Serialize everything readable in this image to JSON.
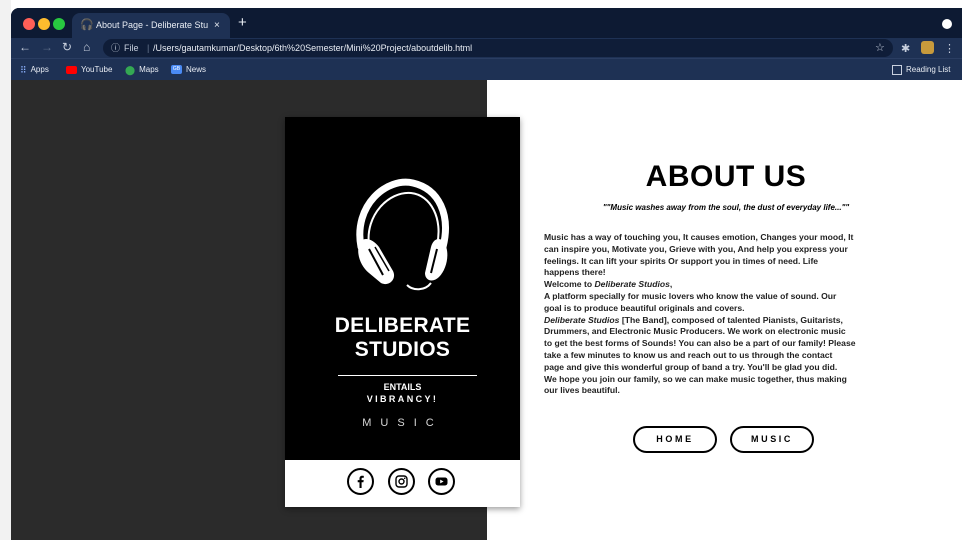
{
  "browser": {
    "tab_title": "About Page - Deliberate Studio",
    "tab_close": "×",
    "new_tab": "+",
    "url_scheme_label": "File",
    "url_separator": "|",
    "url": "/Users/gautamkumar/Desktop/6th%20Semester/Mini%20Project/aboutdelib.html",
    "bookmarks": [
      "Apps",
      "YouTube",
      "Maps",
      "News"
    ],
    "news_icon_text": "GB",
    "reading_list": "Reading List",
    "colors": {
      "frame": "#0d1a33",
      "toolbar": "#1e3154"
    }
  },
  "card": {
    "brand_line1": "DELIBERATE",
    "brand_line2": "STUDIOS",
    "tagline1": "ENTAILS",
    "tagline2": "VIBRANCY!",
    "category": "MUSIC",
    "social_icons": [
      "facebook-icon",
      "instagram-icon",
      "youtube-icon"
    ]
  },
  "about": {
    "title": "ABOUT US",
    "quote": "\"\"Music washes away from the soul, the dust of everyday life...\"\"",
    "lines": [
      "Music has a way of touching you, It causes emotion, Changes your mood, It",
      "can inspire you, Motivate you, Grieve with you, And help you express your",
      "feelings. It can lift your spirits Or support you in times of need. Life",
      "happens there!"
    ],
    "welcome_prefix": "Welcome to ",
    "welcome_brand": "Deliberate Studios",
    "welcome_suffix": ",",
    "platform_lines": [
      "A platform specially for music lovers who know the value of sound. Our",
      "goal is to produce beautiful originals and covers."
    ],
    "band_brand": "Deliberate Studios",
    "band_line1_rest": " [The Band], composed of talented Pianists, Guitarists,",
    "band_lines": [
      "Drummers, and Electronic Music Producers. We work on electronic music",
      "to get the best forms of Sounds! You can also be a part of our family! Please",
      "take a few minutes to know us and reach out to us through the contact",
      "page and give this wonderful group of band a try. You'll be glad you did.",
      "We hope you join our family, so we can make music together, thus making",
      "our lives beautiful."
    ]
  },
  "buttons": {
    "home": "HOME",
    "music": "MUSIC"
  }
}
